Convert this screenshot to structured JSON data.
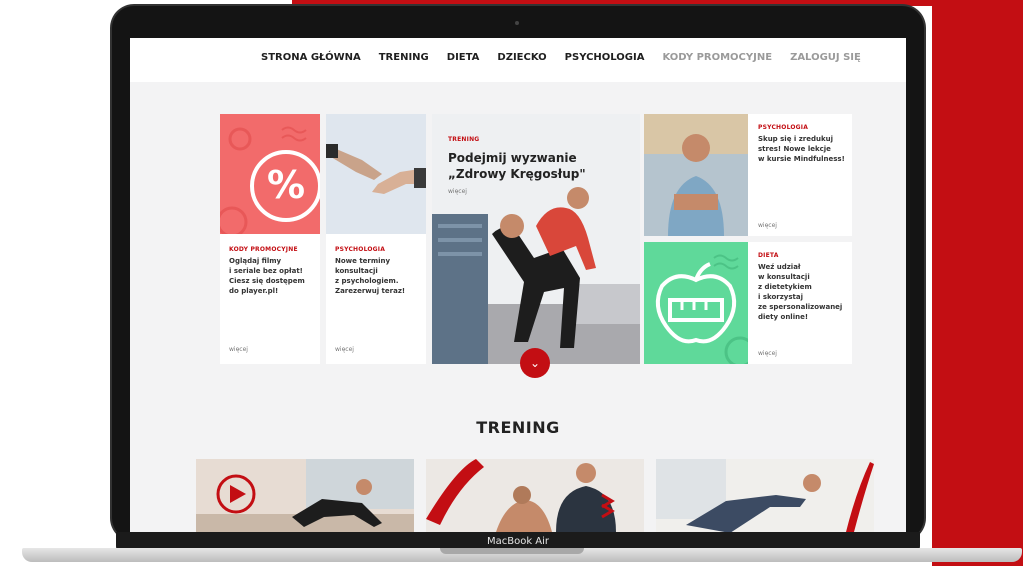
{
  "nav": {
    "items": [
      {
        "label": "STRONA GŁÓWNA"
      },
      {
        "label": "TRENING"
      },
      {
        "label": "DIETA"
      },
      {
        "label": "DZIECKO"
      },
      {
        "label": "PSYCHOLOGIA"
      },
      {
        "label": "KODY PROMOCYJNE"
      },
      {
        "label": "ZALOGUJ SIĘ"
      }
    ]
  },
  "cards": {
    "promo": {
      "category": "KODY PROMOCYJNE",
      "line1": "Oglądaj filmy",
      "line2": "i seriale bez opłat!",
      "line3": "Ciesz się dostępem",
      "line4": "do player.pl!",
      "more": "więcej"
    },
    "psych1": {
      "category": "PSYCHOLOGIA",
      "line1": "Nowe terminy",
      "line2": "konsultacji",
      "line3": "z psychologiem.",
      "line4": "Zarezerwuj teraz!",
      "more": "więcej"
    },
    "hero": {
      "category": "TRENING",
      "title_line1": "Podejmij wyzwanie",
      "title_line2": "„Zdrowy Kręgosłup\"",
      "more": "więcej"
    },
    "psych2": {
      "category": "PSYCHOLOGIA",
      "line1": "Skup się i zredukuj",
      "line2": "stres! Nowe lekcje",
      "line3": "w kursie Mindfulness!",
      "more": "więcej"
    },
    "diet": {
      "category": "DIETA",
      "line1": "Weź udział",
      "line2": "w konsultacji",
      "line3": "z dietetykiem",
      "line4": "i skorzystaj",
      "line5": "ze spersonalizowanej",
      "line6": "diety online!",
      "more": "więcej"
    }
  },
  "section": {
    "title": "TRENING"
  },
  "device": {
    "label": "MacBook Air"
  },
  "colors": {
    "accent": "#c30e13",
    "promo_bg": "#f26b6b",
    "diet_bg": "#5fd99a"
  }
}
